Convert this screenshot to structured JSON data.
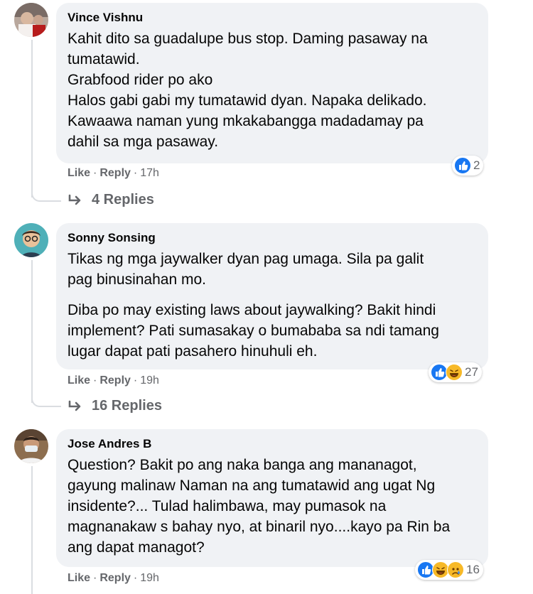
{
  "comments": [
    {
      "author": "Vince Vishnu",
      "paragraphs": [
        "Kahit dito sa guadalupe bus stop. Daming pasaway na",
        "tumatawid.",
        "Grabfood rider po ako",
        "Halos gabi gabi my tumatawid dyan. Napaka delikado.",
        "Kawaawa naman yung mkakabangga madadamay pa",
        "dahil sa mga pasaway."
      ],
      "like": "Like",
      "reply": "Reply",
      "time": "17h",
      "reaction_count": "2",
      "reactions": [
        "like-icon"
      ],
      "replies_label": "4 Replies"
    },
    {
      "author": "Sonny Sonsing",
      "paragraphs": [
        "Tikas ng mga jaywalker dyan pag umaga. Sila pa galit",
        "pag binusinahan mo.",
        "Diba po may existing laws about jaywalking? Bakit hindi",
        "implement? Pati sumasakay o bumababa sa ndi tamang",
        "lugar dapat pati pasahero hinuhuli eh."
      ],
      "like": "Like",
      "reply": "Reply",
      "time": "19h",
      "reaction_count": "27",
      "reactions": [
        "like-icon",
        "haha-icon"
      ],
      "replies_label": "16 Replies"
    },
    {
      "author": "Jose Andres B",
      "paragraphs": [
        "Question? Bakit po ang naka banga ang mananagot,",
        "gayung malinaw Naman na ang tumatawid ang ugat Ng",
        "insidente?... Tulad halimbawa, may pumasok na",
        "magnanakaw s bahay nyo, at binaril nyo....kayo pa Rin ba",
        "ang dapat managot?"
      ],
      "like": "Like",
      "reply": "Reply",
      "time": "19h",
      "reaction_count": "16",
      "reactions": [
        "like-icon",
        "haha-icon",
        "sad-icon"
      ]
    }
  ],
  "colors": {
    "bubble": "#f0f2f5",
    "like_blue": "#1877f2",
    "haha_yellow": "#f7b928",
    "meta_gray": "#65676b"
  }
}
